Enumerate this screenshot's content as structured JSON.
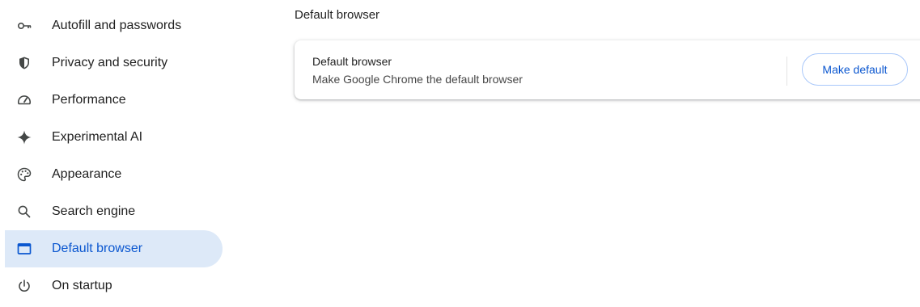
{
  "sidebar": {
    "items": [
      {
        "label": "Autofill and passwords",
        "icon": "key-icon",
        "active": false
      },
      {
        "label": "Privacy and security",
        "icon": "shield-icon",
        "active": false
      },
      {
        "label": "Performance",
        "icon": "speedometer-icon",
        "active": false
      },
      {
        "label": "Experimental AI",
        "icon": "sparkle-icon",
        "active": false
      },
      {
        "label": "Appearance",
        "icon": "palette-icon",
        "active": false
      },
      {
        "label": "Search engine",
        "icon": "search-icon",
        "active": false
      },
      {
        "label": "Default browser",
        "icon": "browser-window-icon",
        "active": true
      },
      {
        "label": "On startup",
        "icon": "power-icon",
        "active": false
      }
    ]
  },
  "main": {
    "section_title": "Default browser",
    "card": {
      "title": "Default browser",
      "subtitle": "Make Google Chrome the default browser",
      "button_label": "Make default"
    }
  },
  "colors": {
    "accent": "#0b57d0",
    "active_bg": "#dde9f8",
    "text": "#1f1f1f",
    "icon": "#444746",
    "button_border": "#a8c7fa"
  }
}
